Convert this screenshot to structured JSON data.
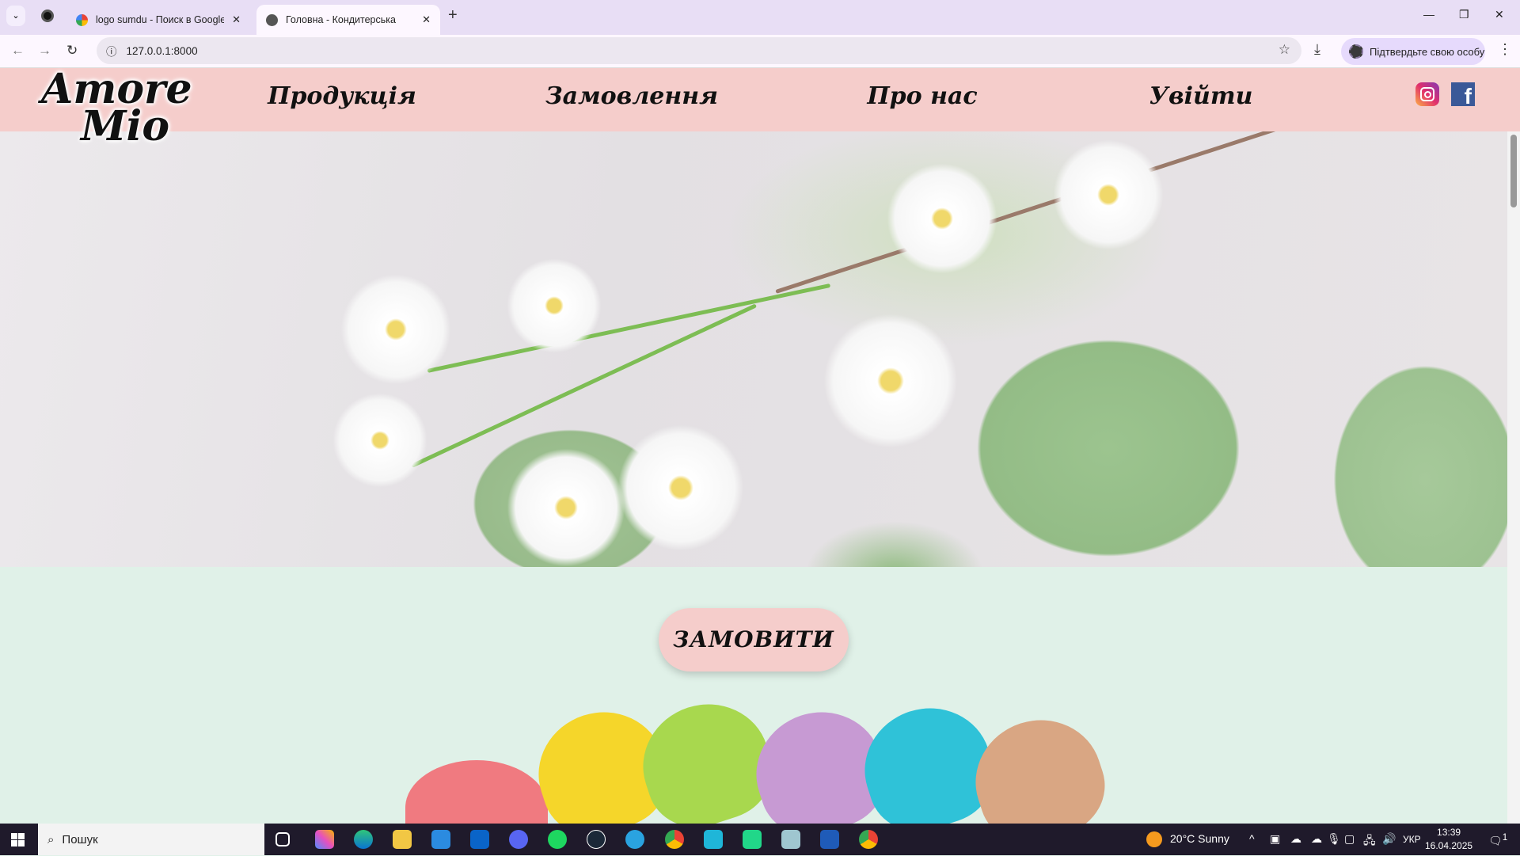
{
  "browser": {
    "tabs": [
      {
        "title": "logo sumdu - Поиск в Google",
        "active": false
      },
      {
        "title": "Головна - Кондитерська",
        "active": true
      }
    ],
    "url": "127.0.0.1:8000",
    "profile_label": "Підтвердьте свою особу"
  },
  "site": {
    "logo_line1": "Amore",
    "logo_line2": "Mio",
    "nav": [
      {
        "label": "Продукція"
      },
      {
        "label": "Замовлення"
      },
      {
        "label": "Про нас"
      },
      {
        "label": "Увійти"
      }
    ],
    "social": [
      "instagram-icon",
      "facebook-icon"
    ],
    "order_button": "ЗАМОВИТИ",
    "colors": {
      "header": "#f5cdcb",
      "section": "#e0f1e8",
      "button": "#f5cdcb"
    }
  },
  "taskbar": {
    "search_placeholder": "Пошук",
    "weather": "20°C  Sunny",
    "language": "УКР",
    "time": "13:39",
    "date": "16.04.2025",
    "notification_count": "1"
  }
}
